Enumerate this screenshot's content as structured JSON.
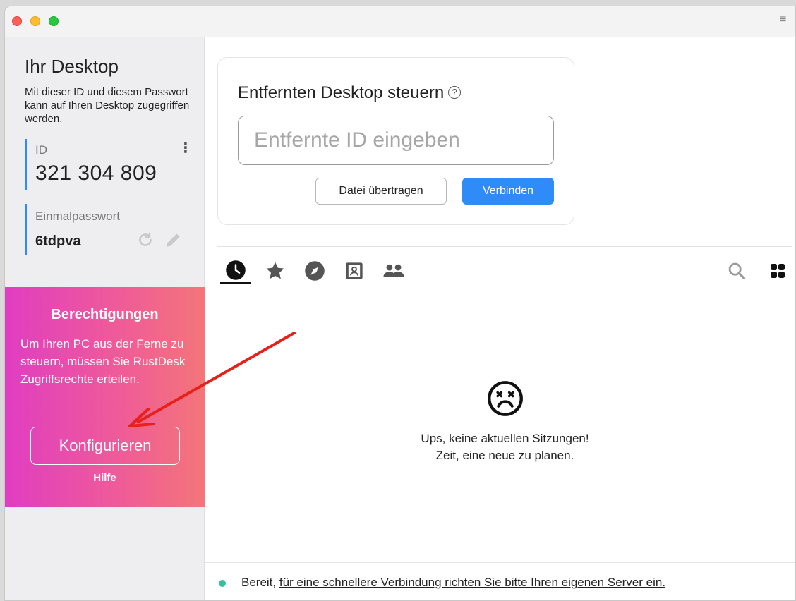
{
  "sidebar": {
    "title": "Ihr Desktop",
    "description": "Mit dieser ID und diesem Passwort kann auf Ihren Desktop zugegriffen werden.",
    "id_label": "ID",
    "id_value": "321 304 809",
    "password_label": "Einmalpasswort",
    "password_value": "6tdpva"
  },
  "permissions": {
    "title": "Berechtigungen",
    "description": "Um Ihren PC aus der Ferne zu steuern, müssen Sie RustDesk Zugriffsrechte erteilen.",
    "configure_label": "Konfigurieren",
    "help_label": "Hilfe"
  },
  "remote": {
    "title": "Entfernten Desktop steuern",
    "help_glyph": "?",
    "id_placeholder": "Entfernte ID eingeben",
    "transfer_label": "Datei übertragen",
    "connect_label": "Verbinden"
  },
  "tabs": {
    "icons": [
      "clock-icon",
      "star-icon",
      "compass-icon",
      "address-book-icon",
      "group-icon"
    ],
    "right_icons": [
      "search-icon",
      "grid-icon"
    ]
  },
  "empty_state": {
    "icon": "sad-face-icon",
    "line1": "Ups, keine aktuellen Sitzungen!",
    "line2": "Zeit, eine neue zu planen."
  },
  "status": {
    "ready": "Bereit,",
    "link": "für eine schnellere Verbindung richten Sie bitte Ihren eigenen Server ein.",
    "dot_color": "#33c19a"
  },
  "colors": {
    "accent": "#2f8bf7",
    "sidebar_marker": "#2c8cff",
    "annotation_arrow": "#e8201a"
  }
}
